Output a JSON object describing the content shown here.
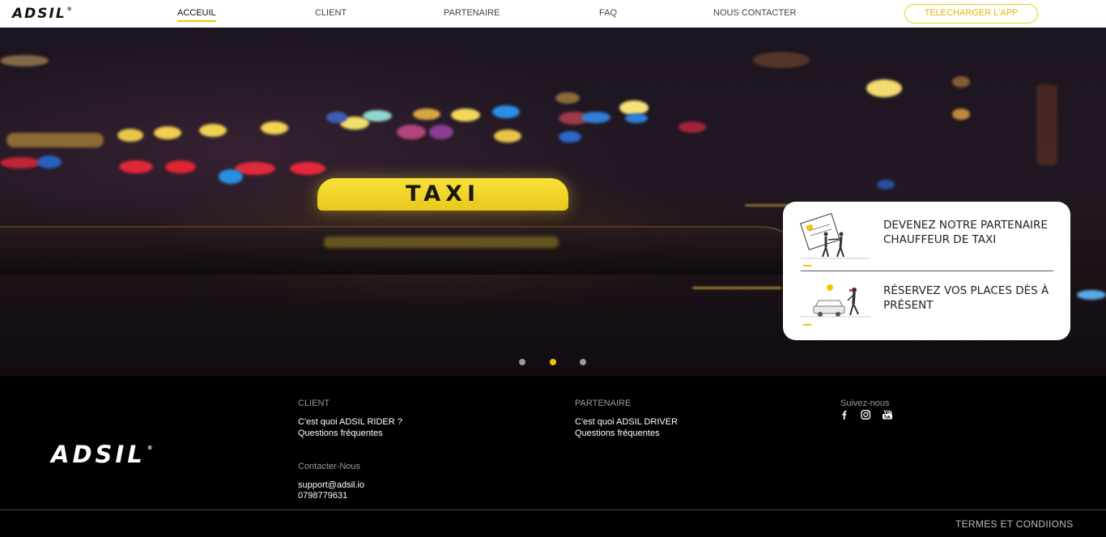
{
  "brand": {
    "name": "ADSIL",
    "registered": "®"
  },
  "nav": {
    "items": [
      {
        "label": "ACCEUIL",
        "active": true
      },
      {
        "label": "CLIENT",
        "active": false
      },
      {
        "label": "PARTENAIRE",
        "active": false
      },
      {
        "label": "FAQ",
        "active": false
      },
      {
        "label": "NOUS CONTACTER",
        "active": false
      }
    ],
    "download_label": "TELECHARGER L'APP"
  },
  "hero": {
    "sign_text": "TAXI",
    "card": {
      "partner_text": "DEVENEZ NOTRE PARTENAIRE CHAUFFEUR DE TAXI",
      "book_text": "RÉSERVEZ VOS PLACES DÈS À PRÉSENT"
    },
    "carousel": {
      "slides": 3,
      "active_index": 1
    }
  },
  "footer": {
    "client": {
      "heading": "CLIENT",
      "links": [
        "C'est quoi ADSIL RIDER ?",
        "Questions fréquentes"
      ]
    },
    "partner": {
      "heading": "PARTENAIRE",
      "links": [
        "C'est quoi ADSIL DRIVER",
        "Questions fréquentes"
      ]
    },
    "social": {
      "heading": "Suivez-nous",
      "icons": [
        "facebook-icon",
        "instagram-icon",
        "youtube-icon"
      ]
    },
    "contact": {
      "heading": "Contacter-Nous",
      "email": "support@adsil.io",
      "phone": "0798779631"
    },
    "terms": "TERMES ET CONDIIONS"
  },
  "colors": {
    "accent": "#f5c400",
    "background": "#000000",
    "navbar": "#ffffff"
  }
}
